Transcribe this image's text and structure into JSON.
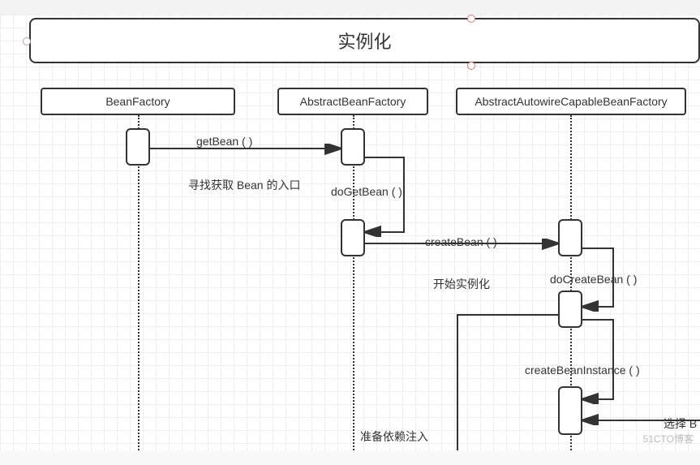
{
  "title": "实例化",
  "participants": {
    "p1": "BeanFactory",
    "p2": "AbstractBeanFactory",
    "p3": "AbstractAutowireCapableBeanFactory"
  },
  "messages": {
    "m1": "getBean ( )",
    "m2": "doGetBean ( )",
    "m3": "createBean ( )",
    "m4": "doCreateBean ( )",
    "m5": "createBeanInstance ( )"
  },
  "notes": {
    "n1": "寻找获取 Bean 的入口",
    "n2": "开始实例化",
    "n3": "准备依赖注入",
    "n4": "选择 B"
  },
  "watermark": "51CTO博客"
}
